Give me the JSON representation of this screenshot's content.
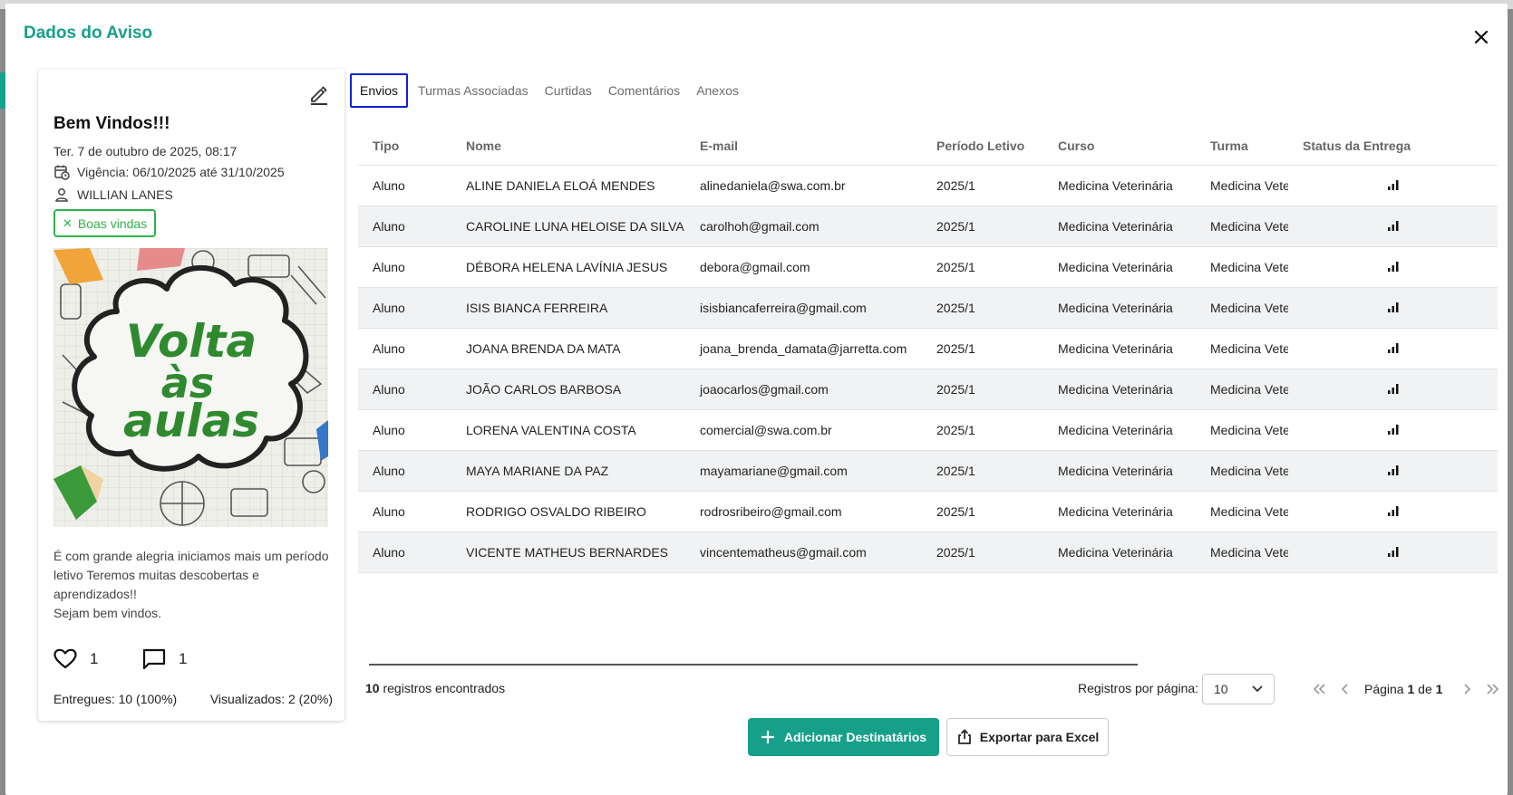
{
  "dialog": {
    "title": "Dados do Aviso",
    "close_label": "×"
  },
  "notice": {
    "title": "Bem Vindos!!!",
    "date": "Ter. 7 de outubro de 2025, 08:17",
    "validity": "Vigência: 06/10/2025 até 31/10/2025",
    "author": "WILLIAN LANES",
    "tag": "Boas vindas",
    "image_text": [
      "Volta",
      "às",
      "aulas"
    ],
    "body_lines": [
      "É com grande alegria iniciamos mais um período letivo Teremos muitas descobertas e aprendizados!!",
      "Sejam bem vindos."
    ],
    "likes": "1",
    "comments": "1",
    "delivered": "Entregues: 10 (100%)",
    "viewed": "Visualizados: 2 (20%)"
  },
  "tabs": [
    {
      "label": "Envios",
      "active": true
    },
    {
      "label": "Turmas Associadas",
      "active": false
    },
    {
      "label": "Curtidas",
      "active": false
    },
    {
      "label": "Comentários",
      "active": false
    },
    {
      "label": "Anexos",
      "active": false
    }
  ],
  "table": {
    "columns": [
      "Tipo",
      "Nome",
      "E-mail",
      "Período Letivo",
      "Curso",
      "Turma",
      "Status da Entrega"
    ],
    "rows": [
      [
        "Aluno",
        "ALINE DANIELA ELOÁ MENDES",
        "alinedaniela@swa.com.br",
        "2025/1",
        "Medicina Veterinária",
        "Medicina Veter"
      ],
      [
        "Aluno",
        "CAROLINE LUNA HELOISE DA SILVA",
        "carolhoh@gmail.com",
        "2025/1",
        "Medicina Veterinária",
        "Medicina Veter"
      ],
      [
        "Aluno",
        "DÉBORA HELENA LAVÍNIA JESUS",
        "debora@gmail.com",
        "2025/1",
        "Medicina Veterinária",
        "Medicina Veter"
      ],
      [
        "Aluno",
        "ISIS BIANCA FERREIRA",
        "isisbiancaferreira@gmail.com",
        "2025/1",
        "Medicina Veterinária",
        "Medicina Veter"
      ],
      [
        "Aluno",
        "JOANA BRENDA DA MATA",
        "joana_brenda_damata@jarretta.com",
        "2025/1",
        "Medicina Veterinária",
        "Medicina Veter"
      ],
      [
        "Aluno",
        "JOÃO CARLOS BARBOSA",
        "joaocarlos@gmail.com",
        "2025/1",
        "Medicina Veterinária",
        "Medicina Veter"
      ],
      [
        "Aluno",
        "LORENA VALENTINA COSTA",
        "comercial@swa.com.br",
        "2025/1",
        "Medicina Veterinária",
        "Medicina Veter"
      ],
      [
        "Aluno",
        "MAYA MARIANE DA PAZ",
        "mayamariane@gmail.com",
        "2025/1",
        "Medicina Veterinária",
        "Medicina Veter"
      ],
      [
        "Aluno",
        "RODRIGO OSVALDO RIBEIRO",
        "rodrosribeiro@gmail.com",
        "2025/1",
        "Medicina Veterinária",
        "Medicina Veter"
      ],
      [
        "Aluno",
        "VICENTE MATHEUS BERNARDES",
        "vincentematheus@gmail.com",
        "2025/1",
        "Medicina Veterinária",
        "Medicina Veter"
      ]
    ],
    "status_icon": "signal-bars-icon"
  },
  "footer": {
    "records_count": "10",
    "records_suffix": "registros encontrados",
    "per_page_label": "Registros por página:",
    "per_page_value": "10",
    "page_prefix": "Página",
    "page_current": "1",
    "page_of": "de",
    "page_total": "1"
  },
  "actions": {
    "add_label": "Adicionar Destinatários",
    "export_label": "Exportar para Excel"
  },
  "colors": {
    "accent": "#16a08a",
    "tag": "#2fb34a",
    "active_tab_border": "#1020d6"
  }
}
